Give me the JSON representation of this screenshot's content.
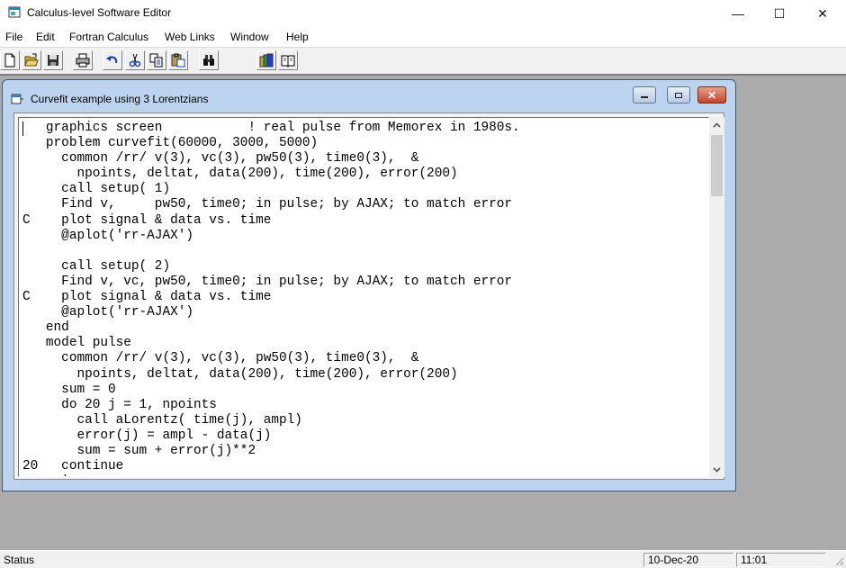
{
  "app": {
    "title": "Calculus-level Software Editor",
    "window_controls": {
      "minimize": "—",
      "maximize": "☐",
      "close": "✕"
    }
  },
  "menu": {
    "items": [
      "File",
      "Edit",
      "Fortran Calculus",
      "Web Links",
      "Window",
      "Help"
    ]
  },
  "toolbar": {
    "buttons": [
      "new-file",
      "open-folder",
      "save",
      "print",
      "undo",
      "cut",
      "copy",
      "paste",
      "find",
      "library-books",
      "open-book"
    ]
  },
  "document": {
    "title": "Curvefit example using 3 Lorentzians",
    "controls": {
      "close": "✕"
    },
    "code": "   graphics screen           ! real pulse from Memorex in 1980s.\n   problem curvefit(60000, 3000, 5000)\n     common /rr/ v(3), vc(3), pw50(3), time0(3),  &\n       npoints, deltat, data(200), time(200), error(200)\n     call setup( 1)\n     Find v,     pw50, time0; in pulse; by AJAX; to match error\nC    plot signal & data vs. time\n     @aplot('rr-AJAX')\n\n     call setup( 2)\n     Find v, vc, pw50, time0; in pulse; by AJAX; to match error\nC    plot signal & data vs. time\n     @aplot('rr-AJAX')\n   end\n   model pulse\n     common /rr/ v(3), vc(3), pw50(3), time0(3),  &\n       npoints, deltat, data(200), time(200), error(200)\n     sum = 0\n     do 20 j = 1, npoints\n       call aLorentz( time(j), ampl)\n       error(j) = ampl - data(j)\n       sum = sum + error(j)**2\n20   continue\n     '",
    "scroll": {
      "up": "⌃",
      "down": "⌄"
    }
  },
  "status": {
    "text": "Status",
    "date": "10-Dec-20",
    "time": "11:01"
  }
}
